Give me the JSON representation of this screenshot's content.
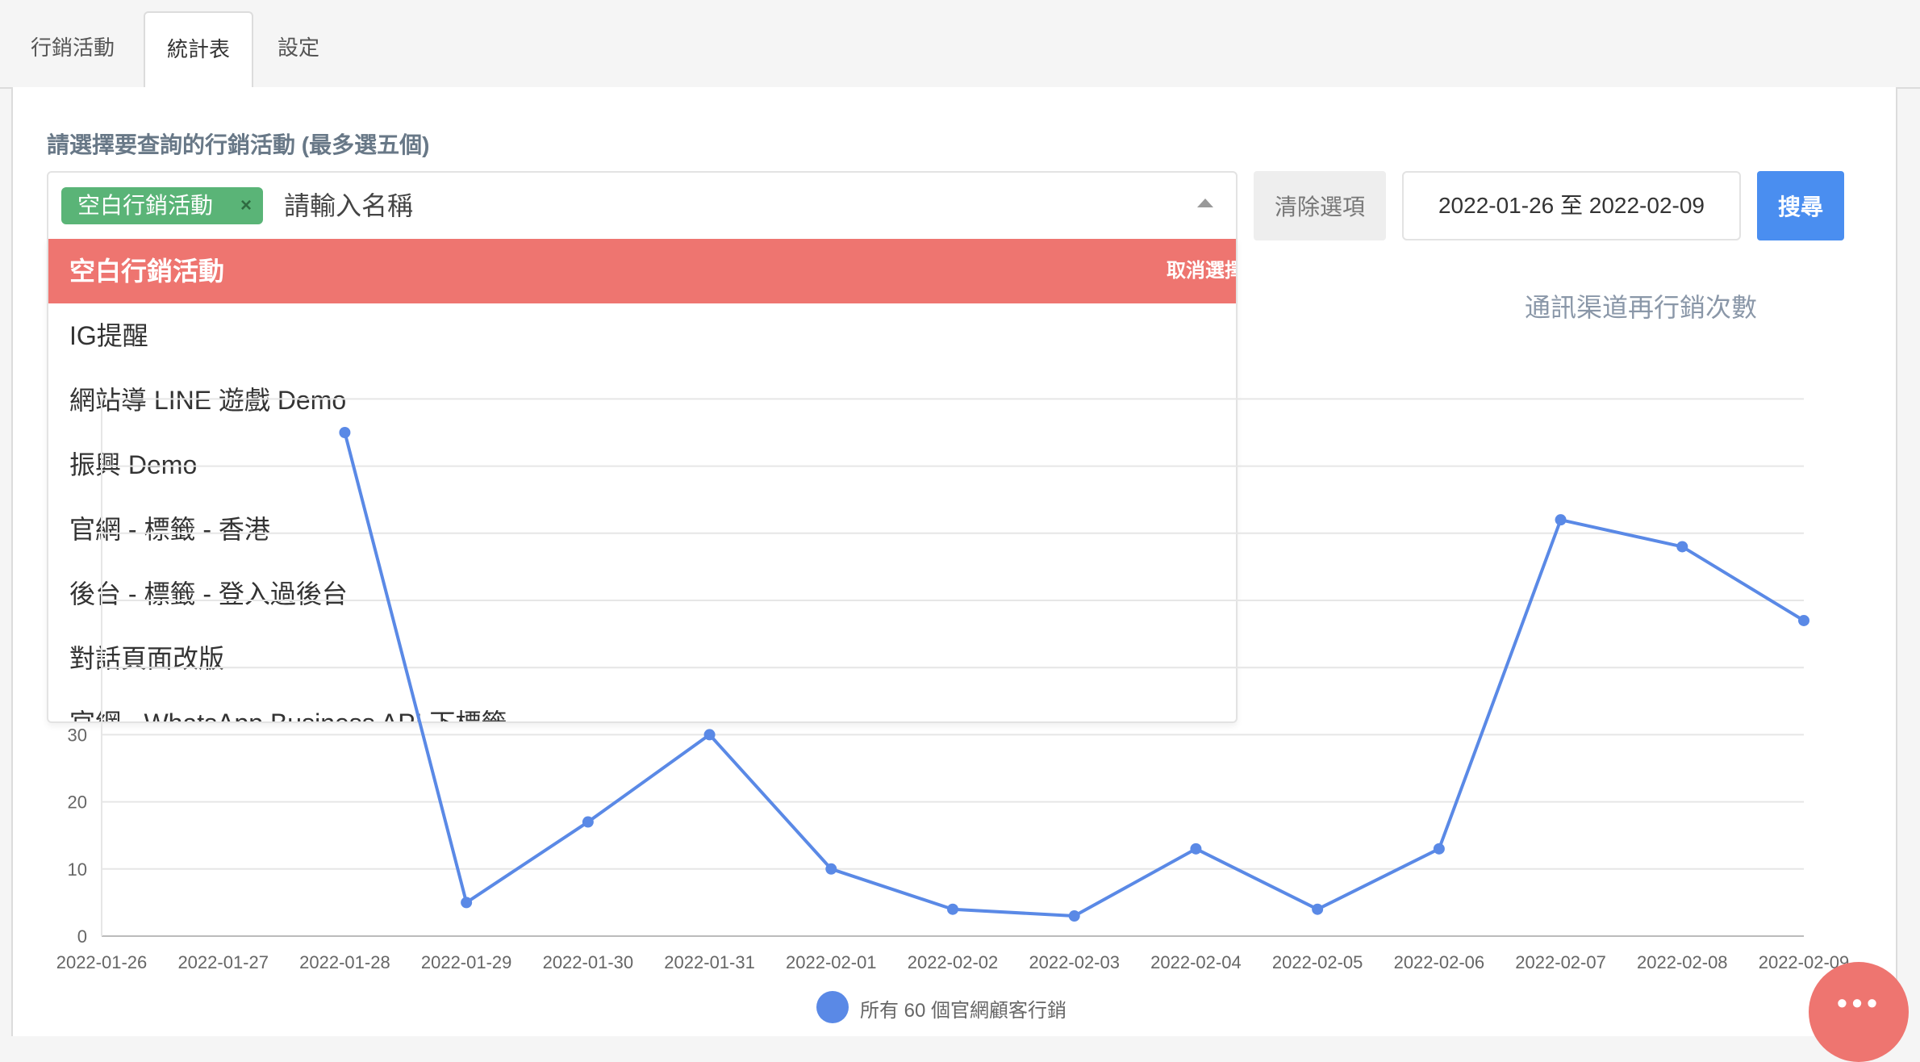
{
  "tabs": [
    {
      "label": "行銷活動"
    },
    {
      "label": "統計表"
    },
    {
      "label": "設定"
    }
  ],
  "filter": {
    "label": "請選擇要查詢的行銷活動 (最多選五個)",
    "chip_label": "空白行銷活動",
    "chip_remove": "×",
    "placeholder": "請輸入名稱",
    "clear_label": "清除選項",
    "date_range": "2022-01-26 至 2022-02-09",
    "search_label": "搜尋"
  },
  "dropdown": {
    "options": [
      {
        "label": "空白行銷活動",
        "hint": "取消選擇"
      },
      {
        "label": "IG提醒"
      },
      {
        "label": "網站導 LINE 遊戲 Demo"
      },
      {
        "label": "振興 Demo"
      },
      {
        "label": "官網 - 標籤 - 香港"
      },
      {
        "label": "後台 - 標籤 - 登入過後台"
      },
      {
        "label": "對話頁面改版"
      },
      {
        "label": "官網 - WhatsApp Business API 下標籤"
      }
    ]
  },
  "chat": {
    "dots": "•••"
  },
  "colors": {
    "accent": "#4a8ef0",
    "series": "#5a89e6",
    "selected": "#ee7570",
    "chip": "#5ab477"
  },
  "chart_data": {
    "type": "line",
    "title": "通訊渠道再行銷次數",
    "x": [
      "2022-01-26",
      "2022-01-27",
      "2022-01-28",
      "2022-01-29",
      "2022-01-30",
      "2022-01-31",
      "2022-02-01",
      "2022-02-02",
      "2022-02-03",
      "2022-02-04",
      "2022-02-05",
      "2022-02-06",
      "2022-02-07",
      "2022-02-08",
      "2022-02-09"
    ],
    "series": [
      {
        "name": "所有 60 個官網顧客行銷",
        "values": [
          null,
          null,
          75,
          5,
          17,
          30,
          10,
          4,
          3,
          13,
          4,
          13,
          62,
          58,
          47
        ]
      }
    ],
    "yticks": [
      0,
      10,
      20,
      30
    ],
    "ylim": [
      0,
      80
    ],
    "grid": true,
    "legend": "bottom"
  }
}
